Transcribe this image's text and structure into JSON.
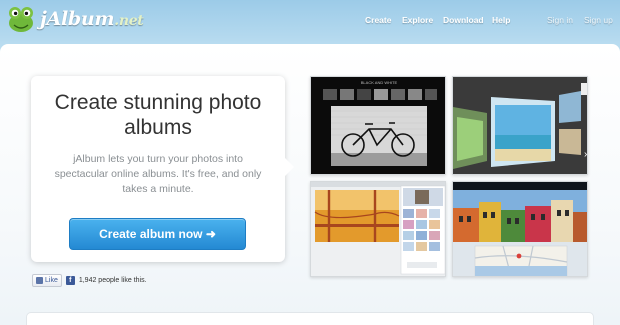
{
  "brand": {
    "logo_text": "jAlbum",
    "logo_suffix": ".net"
  },
  "nav": {
    "items": [
      {
        "label": "Create"
      },
      {
        "label": "Explore"
      },
      {
        "label": "Download"
      },
      {
        "label": "Help"
      }
    ],
    "sign_in": "Sign in",
    "sign_up": "Sign up"
  },
  "hero": {
    "title": "Create stunning photo albums",
    "description": "jAlbum lets you turn your photos into spectacular online albums. It's free, and only takes a minute.",
    "cta_label": "Create album now ➜"
  },
  "social": {
    "like_label": "Like",
    "like_count_text": "1,942 people like this."
  },
  "screenshots": {
    "shot1_caption": "BLACK AND WHITE"
  },
  "colors": {
    "sky": "#9ccbe8",
    "cta": "#2b8fd6",
    "text": "#333333",
    "muted": "#8a8f93"
  }
}
